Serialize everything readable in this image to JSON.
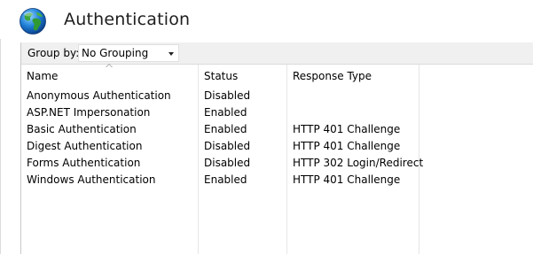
{
  "header": {
    "title": "Authentication",
    "icon": "globe-icon"
  },
  "toolbar": {
    "group_by_label": "Group by:",
    "group_by_value": "No Grouping"
  },
  "table": {
    "columns": [
      "Name",
      "Status",
      "Response Type"
    ],
    "sort": {
      "column": "Name",
      "direction": "ascending"
    },
    "rows": [
      {
        "name": "Anonymous Authentication",
        "status": "Disabled",
        "response_type": ""
      },
      {
        "name": "ASP.NET Impersonation",
        "status": "Enabled",
        "response_type": ""
      },
      {
        "name": "Basic Authentication",
        "status": "Enabled",
        "response_type": "HTTP 401 Challenge"
      },
      {
        "name": "Digest Authentication",
        "status": "Disabled",
        "response_type": "HTTP 401 Challenge"
      },
      {
        "name": "Forms Authentication",
        "status": "Disabled",
        "response_type": "HTTP 302 Login/Redirect"
      },
      {
        "name": "Windows Authentication",
        "status": "Enabled",
        "response_type": "HTTP 401 Challenge"
      }
    ]
  }
}
